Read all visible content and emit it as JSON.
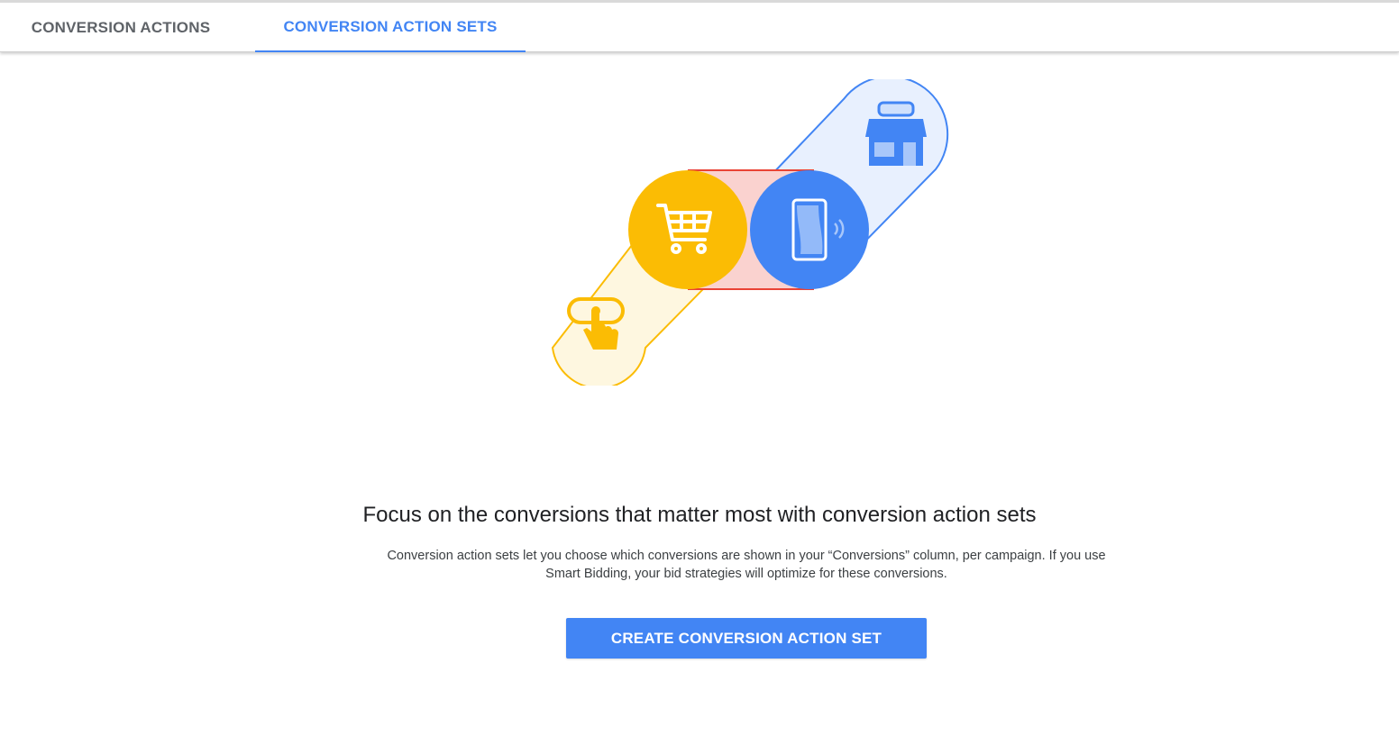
{
  "tabs": [
    {
      "label": "CONVERSION ACTIONS",
      "active": false
    },
    {
      "label": "CONVERSION ACTION SETS",
      "active": true
    }
  ],
  "colors": {
    "accent": "#4285f4",
    "yellow": "#fbbc04",
    "red": "#ea4335",
    "text_primary": "#202124",
    "text_secondary": "#3c4043",
    "tab_inactive": "#5f6368"
  },
  "illustration": {
    "icons": [
      "click-icon",
      "shopping-cart-icon",
      "mobile-phone-icon",
      "storefront-icon"
    ]
  },
  "main": {
    "headline": "Focus on the conversions that matter most with conversion action sets",
    "description_line1": "Conversion action sets let you choose which conversions are shown in your “Conversions” column, per campaign. If you use",
    "description_line2": "Smart Bidding, your bid strategies will optimize for these conversions.",
    "cta_label": "CREATE CONVERSION ACTION SET"
  }
}
